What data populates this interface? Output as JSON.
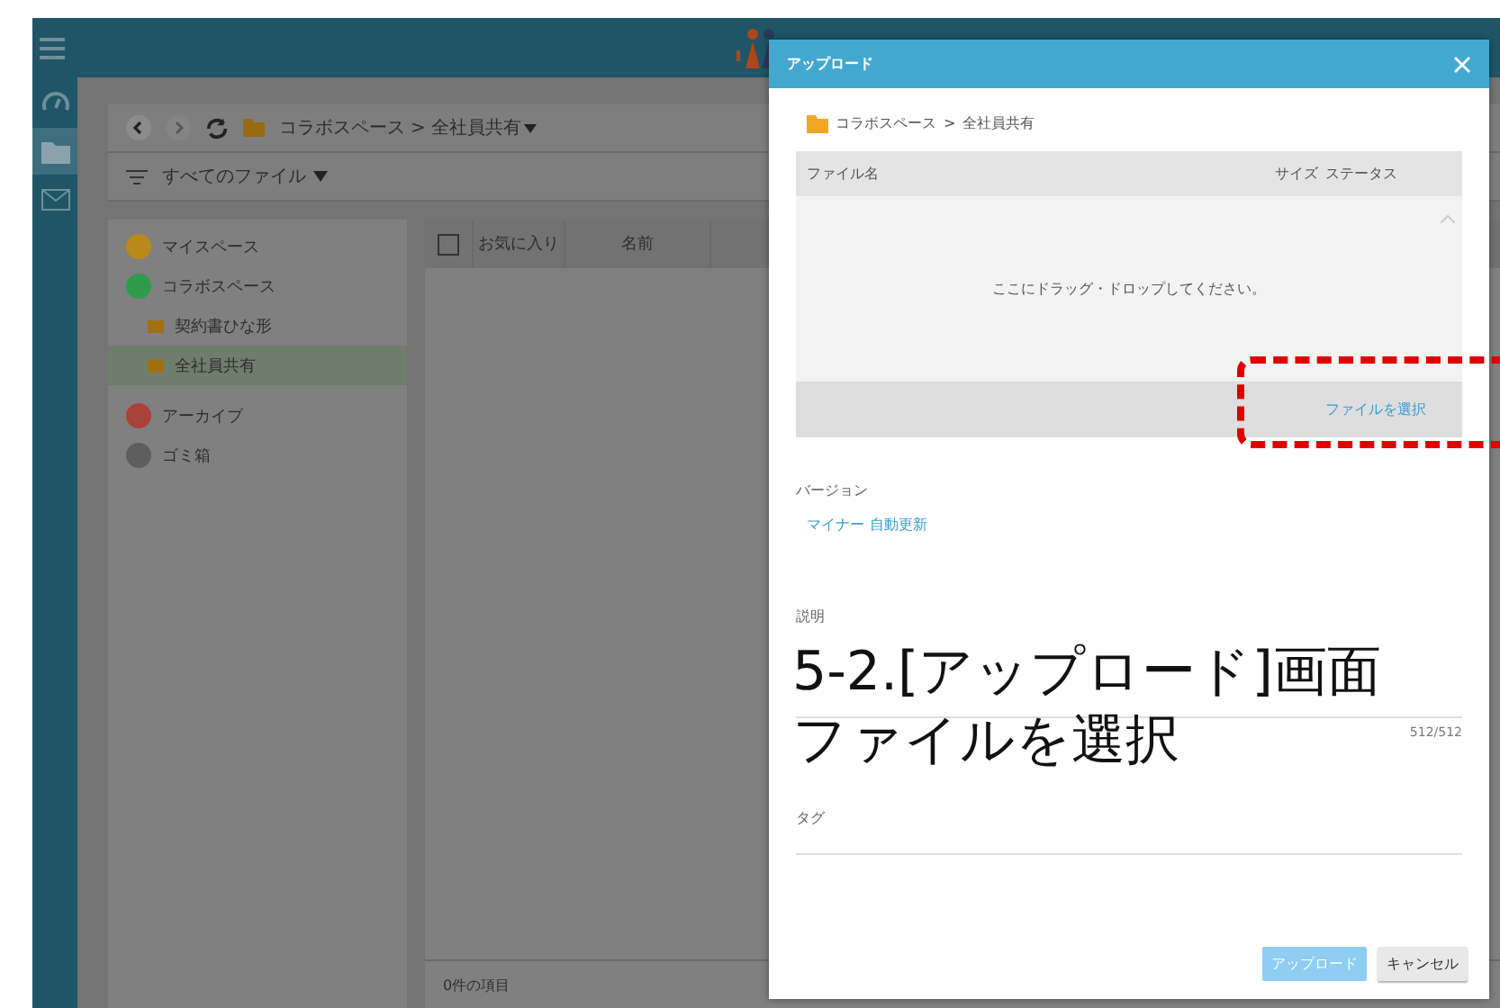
{
  "app": {
    "breadcrumb": {
      "path": [
        "コラボスペース",
        "全社員共有"
      ],
      "separator": ">"
    },
    "filter": "すべてのファイル",
    "tree": [
      {
        "label": "マイスペース",
        "color": "#b88a1a",
        "selected": false
      },
      {
        "label": "コラボスペース",
        "color": "#2f9a4a",
        "selected": false,
        "children": [
          {
            "label": "契約書ひな形",
            "selected": false
          },
          {
            "label": "全社員共有",
            "selected": true
          }
        ]
      },
      {
        "label": "アーカイブ",
        "color": "#a8433a",
        "selected": false
      },
      {
        "label": "ゴミ箱",
        "color": "#5e5e5e",
        "selected": false
      }
    ],
    "table": {
      "columns": [
        "お気に入り",
        "名前"
      ],
      "all_checked": false
    },
    "status": "0件の項目"
  },
  "dialog": {
    "title": "アップロード",
    "path": [
      "コラボスペース",
      "全社員共有"
    ],
    "separator": ">",
    "columns": [
      "ファイル名",
      "サイズ",
      "ステータス"
    ],
    "drop_hint": "ここにドラッグ・ドロップしてください。",
    "select_button": "ファイルを選択",
    "version_label": "バージョン",
    "version_value": [
      "マイナー",
      "自動更新"
    ],
    "description_label": "説明",
    "counter": "512/512",
    "tag_label": "タグ",
    "buttons": [
      {
        "label": "アップロード",
        "kind": "primary",
        "disabled": true
      },
      {
        "label": "キャンセル",
        "kind": "secondary"
      }
    ]
  },
  "annotation": {
    "lines": [
      "5-2.[アップロード]画面",
      "ファイルを選択"
    ]
  }
}
